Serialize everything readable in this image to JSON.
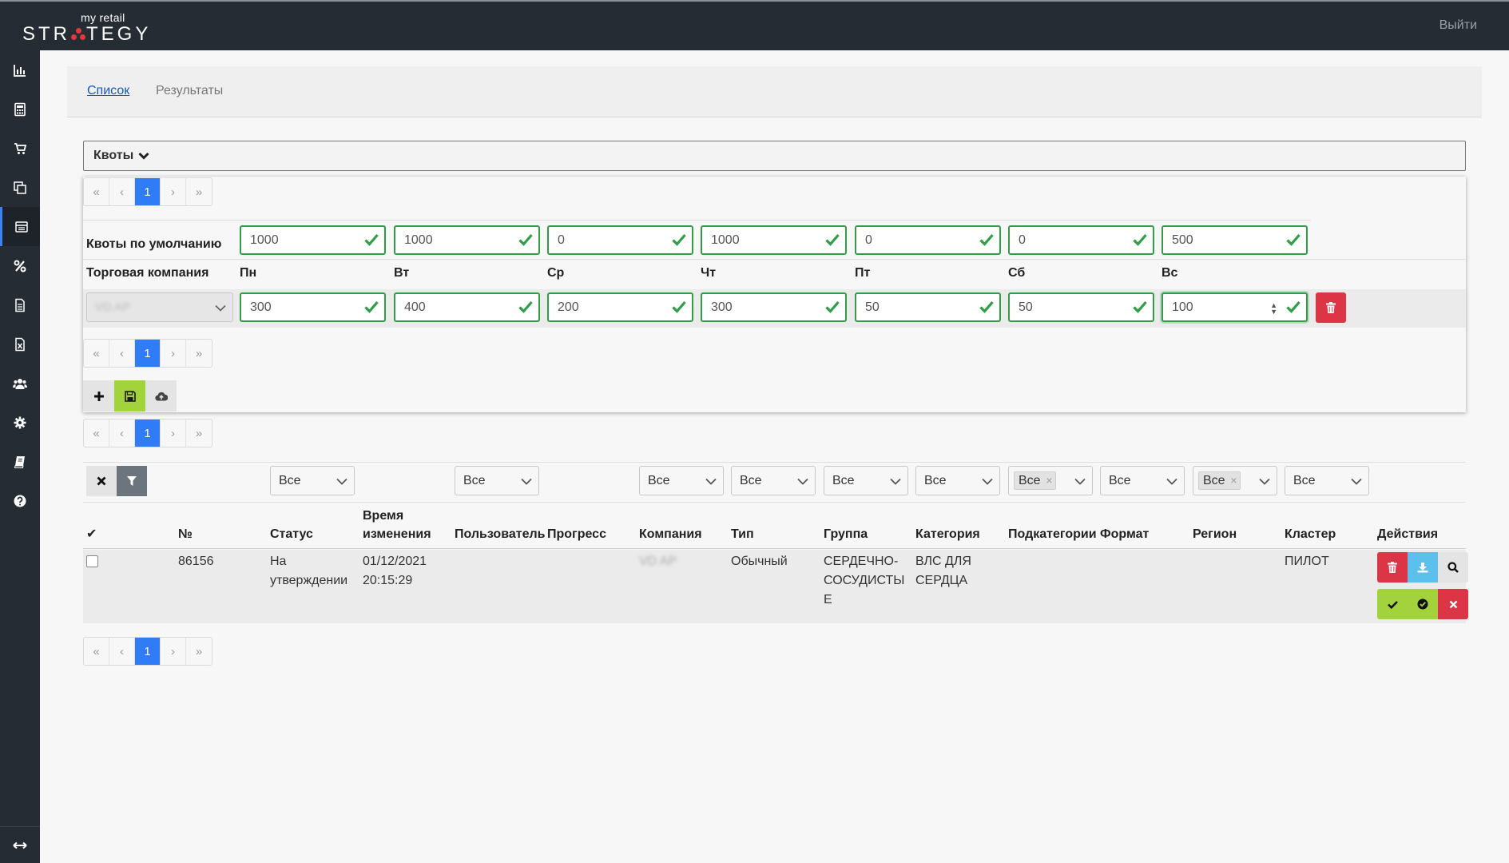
{
  "header": {
    "logo_small": "my retail",
    "logo_left": "STR",
    "logo_right": "TEGY",
    "logout": "Выйти"
  },
  "sidebar": {
    "items": [
      {
        "icon": "bar-chart-icon"
      },
      {
        "icon": "calculator-icon"
      },
      {
        "icon": "cart-icon"
      },
      {
        "icon": "copy-icon"
      },
      {
        "icon": "list-icon",
        "active": true
      },
      {
        "icon": "percent-icon"
      },
      {
        "icon": "document-icon"
      },
      {
        "icon": "excel-file-icon"
      },
      {
        "icon": "users-icon"
      },
      {
        "icon": "gear-icon"
      },
      {
        "icon": "book-icon"
      },
      {
        "icon": "help-icon"
      }
    ],
    "bottom_icon": "expand-arrows-icon"
  },
  "tabs": {
    "list": "Список",
    "results": "Результаты"
  },
  "quotas": {
    "title": "Квоты",
    "pager": [
      "«",
      "‹",
      "1",
      "›",
      "»"
    ],
    "default_label": "Квоты по умолчанию",
    "default_values": [
      "1000",
      "1000",
      "0",
      "1000",
      "0",
      "0",
      "500"
    ],
    "company_label": "Торговая компания",
    "days": [
      "Пн",
      "Вт",
      "Ср",
      "Чт",
      "Пт",
      "Сб",
      "Вс"
    ],
    "company_value": "VD AP",
    "row_values": [
      "300",
      "400",
      "200",
      "300",
      "50",
      "50",
      "100"
    ]
  },
  "filters": {
    "all": "Все"
  },
  "table": {
    "headers": {
      "check": "✔",
      "number": "№",
      "status": "Статус",
      "time_line1": "Время",
      "time_line2": "изменения",
      "user": "Пользователь",
      "progress": "Прогресс",
      "company": "Компания",
      "type": "Тип",
      "group": "Группа",
      "category": "Категория",
      "subcategories": "Подкатегории",
      "format": "Формат",
      "region": "Регион",
      "cluster": "Кластер",
      "actions": "Действия"
    },
    "rows": [
      {
        "number": "86156",
        "status_line1": "На",
        "status_line2": "утверждении",
        "time_line1": "01/12/2021",
        "time_line2": "20:15:29",
        "company": "VD AP",
        "type": "Обычный",
        "group_line1": "СЕРДЕЧНО-",
        "group_line2": "СОСУДИСТЫ",
        "group_line3": "Е",
        "category_line1": "ВЛС ДЛЯ",
        "category_line2": "СЕРДЦА",
        "cluster": "ПИЛОТ"
      }
    ]
  },
  "colors": {
    "topbar": "#252c33",
    "accent_blue": "#2f7cf6",
    "valid_green": "#2f9e44",
    "danger_red": "#dc3545",
    "lime": "#a3d33c",
    "info_blue": "#5bc0eb"
  }
}
